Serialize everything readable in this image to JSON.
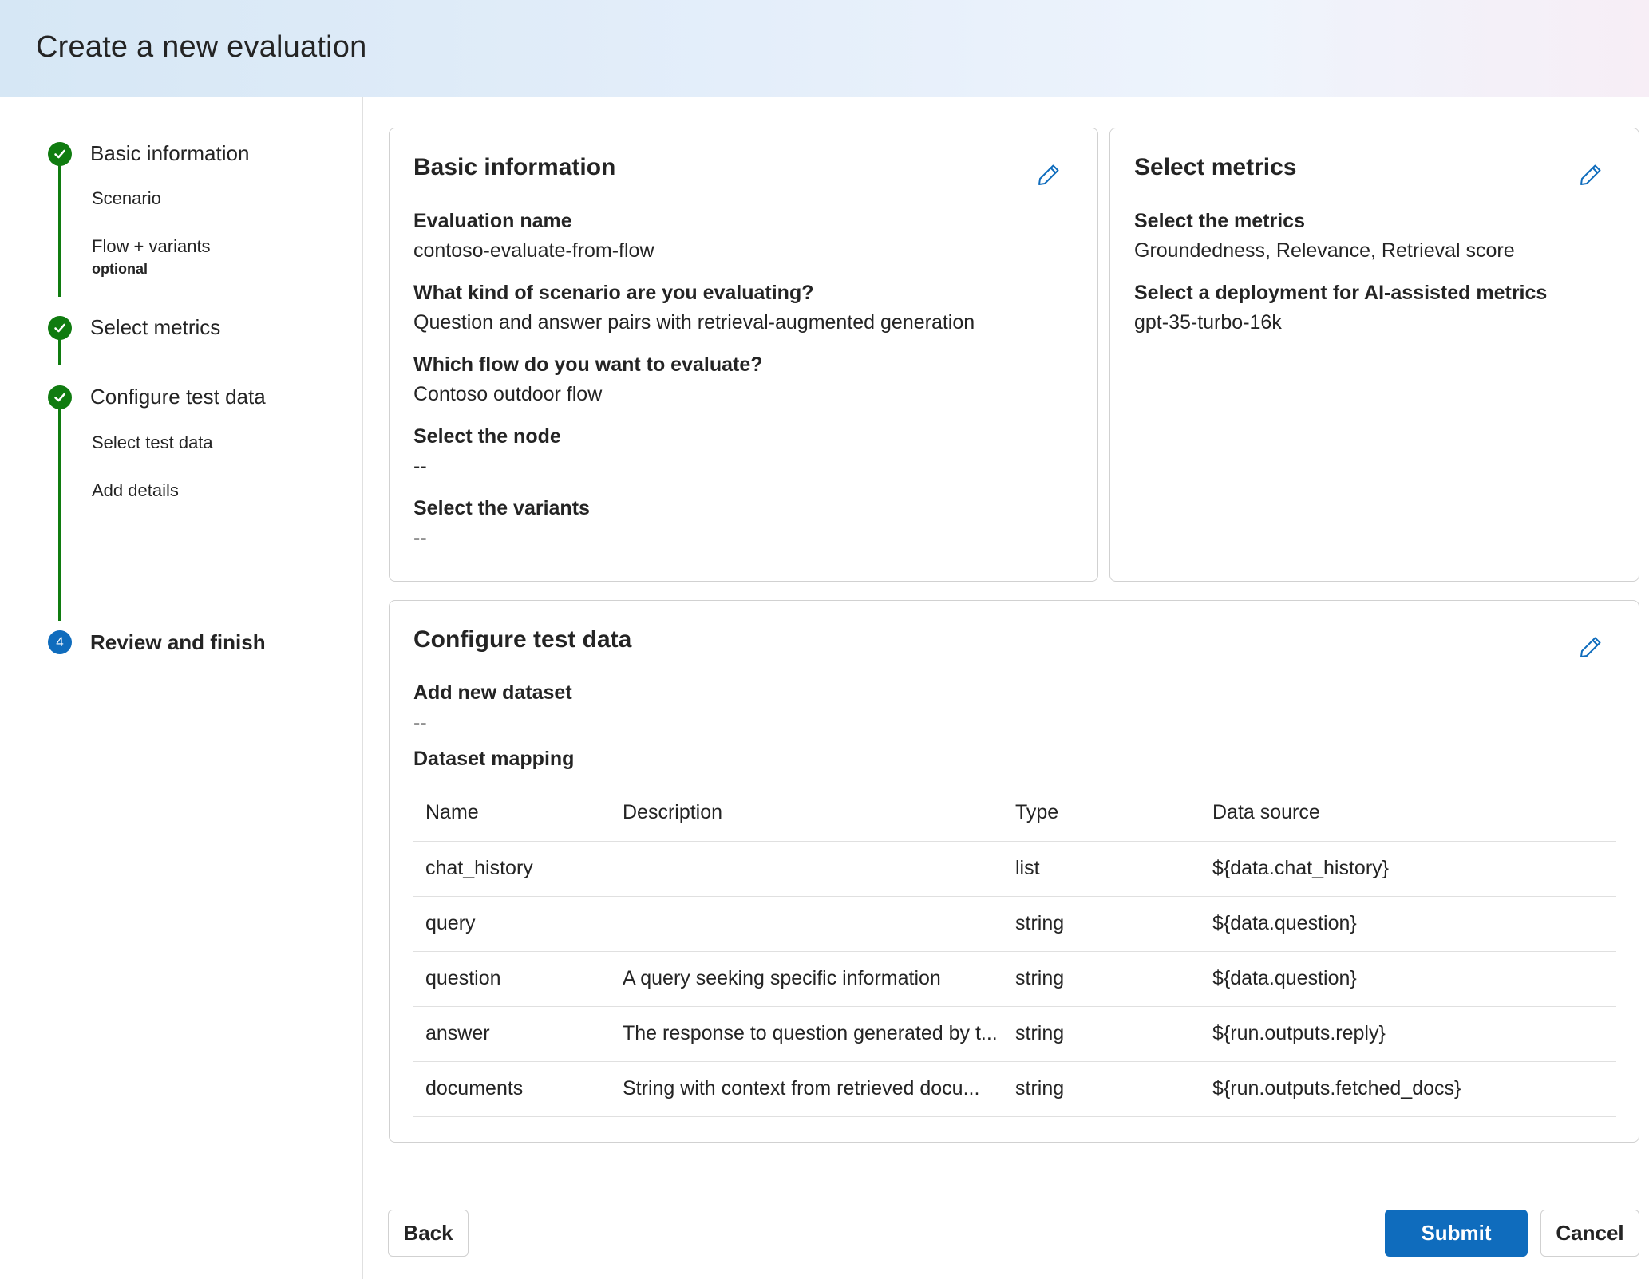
{
  "header": {
    "title": "Create a new evaluation"
  },
  "sidebar": {
    "steps": [
      {
        "label": "Basic information",
        "status": "complete",
        "icon": "checkmark-icon"
      },
      {
        "label": "Select metrics",
        "status": "complete",
        "icon": "checkmark-icon"
      },
      {
        "label": "Configure test data",
        "status": "complete",
        "icon": "checkmark-icon"
      },
      {
        "label": "Review and finish",
        "status": "current",
        "number": "4"
      }
    ],
    "substeps": {
      "scenario": "Scenario",
      "flow_variants": "Flow + variants",
      "flow_variants_note": "optional",
      "select_test_data": "Select test data",
      "add_details": "Add details"
    }
  },
  "basic_info": {
    "title": "Basic information",
    "fields": [
      {
        "label": "Evaluation name",
        "value": "contoso-evaluate-from-flow"
      },
      {
        "label": "What kind of scenario are you evaluating?",
        "value": "Question and answer pairs with retrieval-augmented generation"
      },
      {
        "label": "Which flow do you want to evaluate?",
        "value": "Contoso outdoor flow"
      },
      {
        "label": "Select the node",
        "value": "--"
      },
      {
        "label": "Select the variants",
        "value": "--"
      }
    ]
  },
  "metrics": {
    "title": "Select metrics",
    "fields": [
      {
        "label": "Select the metrics",
        "value": "Groundedness, Relevance, Retrieval score"
      },
      {
        "label": "Select a deployment for AI-assisted metrics",
        "value": "gpt-35-turbo-16k"
      }
    ]
  },
  "test_data": {
    "title": "Configure test data",
    "dataset_label": "Add new dataset",
    "dataset_value": "--",
    "mapping_label": "Dataset mapping",
    "columns": [
      "Name",
      "Description",
      "Type",
      "Data source"
    ],
    "rows": [
      [
        "chat_history",
        "",
        "list",
        "${data.chat_history}"
      ],
      [
        "query",
        "",
        "string",
        "${data.question}"
      ],
      [
        "question",
        "A query seeking specific information",
        "string",
        "${data.question}"
      ],
      [
        "answer",
        "The response to question generated by t...",
        "string",
        "${run.outputs.reply}"
      ],
      [
        "documents",
        "String with context from retrieved docu...",
        "string",
        "${run.outputs.fetched_docs}"
      ]
    ]
  },
  "footer": {
    "back": "Back",
    "submit": "Submit",
    "cancel": "Cancel"
  },
  "colors": {
    "accent": "#0f6cbd",
    "success": "#107c10"
  }
}
